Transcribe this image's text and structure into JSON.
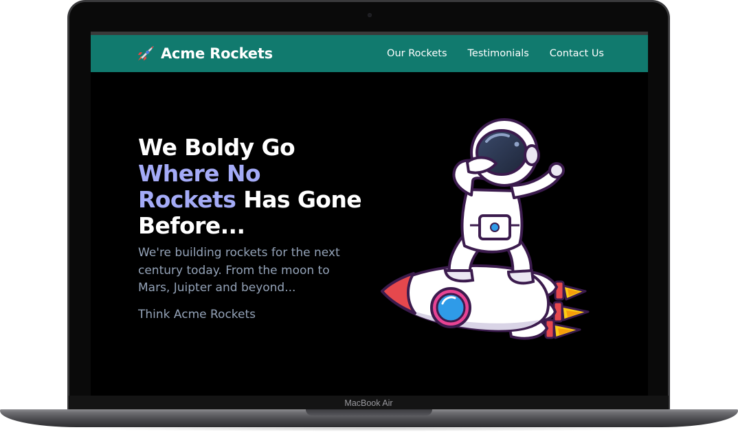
{
  "device": {
    "label": "MacBook Air"
  },
  "site": {
    "brand": {
      "name": "Acme Rockets",
      "icon": "rocket-icon"
    },
    "nav": [
      {
        "label": "Our Rockets"
      },
      {
        "label": "Testimonials"
      },
      {
        "label": "Contact Us"
      }
    ]
  },
  "hero": {
    "title_line1": "We Boldy Go",
    "title_accent1": "Where No",
    "title_accent2": "Rockets",
    "title_rest": " Has Gone",
    "title_line4": "Before...",
    "subtitle": "We're building rockets for the next century today. From the moon to Mars, Juipter and beyond...",
    "tagline": "Think Acme Rockets",
    "illustration": "astronaut-riding-rocket"
  },
  "colors": {
    "nav_background": "#117a6e",
    "accent_text": "#a4abf7",
    "muted_text": "#94a3b8",
    "page_background": "#000000"
  }
}
